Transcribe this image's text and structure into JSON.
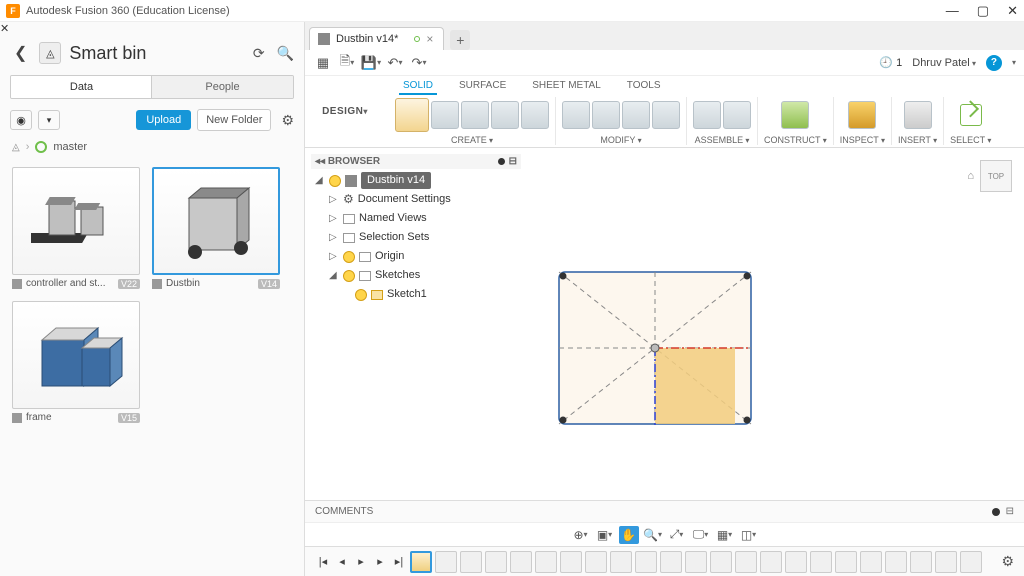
{
  "titlebar": {
    "app_title": "Autodesk Fusion 360 (Education License)",
    "logo_letter": "F"
  },
  "data_panel": {
    "title": "Smart bin",
    "tabs": {
      "data": "Data",
      "people": "People"
    },
    "upload": "Upload",
    "new_folder": "New Folder",
    "branch": "master",
    "items": [
      {
        "name": "controller and st...",
        "version": "V22"
      },
      {
        "name": "Dustbin",
        "version": "V14"
      },
      {
        "name": "frame",
        "version": "V15"
      }
    ]
  },
  "document": {
    "tab_name": "Dustbin v14*"
  },
  "qat": {
    "recovery_count": "1",
    "user": "Dhruv Patel"
  },
  "ribbon": {
    "workspace": "DESIGN",
    "env_tabs": [
      "SOLID",
      "SURFACE",
      "SHEET METAL",
      "TOOLS"
    ],
    "groups": [
      "CREATE",
      "MODIFY",
      "ASSEMBLE",
      "CONSTRUCT",
      "INSPECT",
      "INSERT",
      "SELECT"
    ]
  },
  "browser": {
    "title": "BROWSER",
    "root": "Dustbin v14",
    "items": [
      "Document Settings",
      "Named Views",
      "Selection Sets",
      "Origin",
      "Sketches"
    ],
    "sketch": "Sketch1"
  },
  "viewcube": {
    "face": "TOP"
  },
  "comments": {
    "label": "COMMENTS"
  }
}
